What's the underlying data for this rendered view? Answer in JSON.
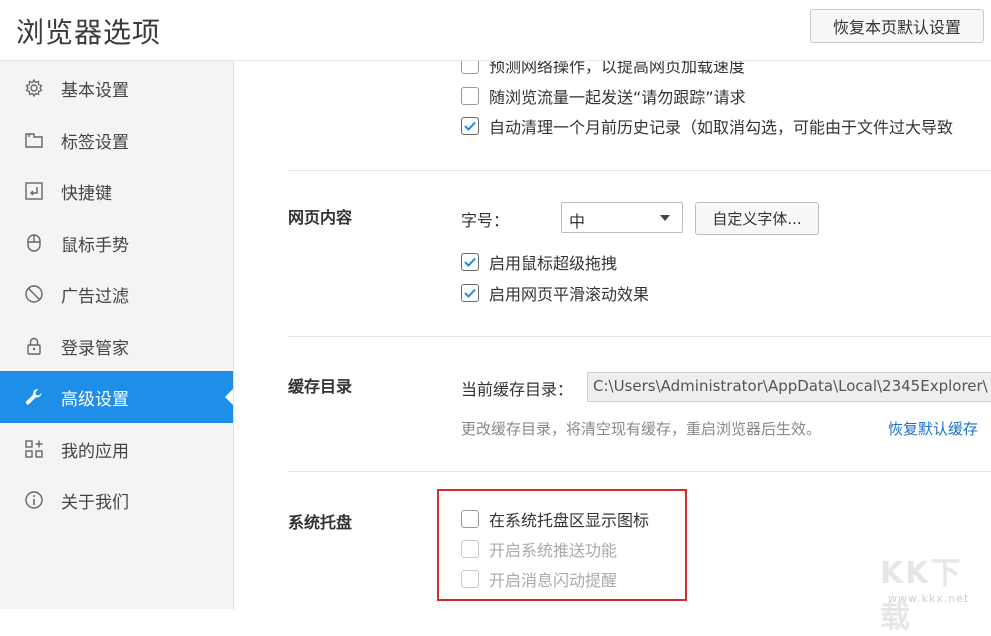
{
  "header": {
    "title": "浏览器选项",
    "reset_button": "恢复本页默认设置"
  },
  "sidebar": {
    "items": [
      {
        "label": "基本设置",
        "icon": "gear-icon"
      },
      {
        "label": "标签设置",
        "icon": "tabs-icon"
      },
      {
        "label": "快捷键",
        "icon": "shortcut-icon"
      },
      {
        "label": "鼠标手势",
        "icon": "mouse-icon"
      },
      {
        "label": "广告过滤",
        "icon": "block-icon"
      },
      {
        "label": "登录管家",
        "icon": "lock-icon"
      },
      {
        "label": "高级设置",
        "icon": "wrench-icon",
        "active": true
      },
      {
        "label": "我的应用",
        "icon": "apps-icon"
      },
      {
        "label": "关于我们",
        "icon": "info-icon"
      }
    ]
  },
  "privacy": {
    "options": [
      {
        "label": "预测网络操作，以提高网页加载速度",
        "checked": false
      },
      {
        "label": "随浏览流量一起发送“请勿跟踪”请求",
        "checked": false
      },
      {
        "label": "自动清理一个月前历史记录（如取消勾选，可能由于文件过大导致",
        "checked": true
      }
    ]
  },
  "web_content": {
    "title": "网页内容",
    "font_size_label": "字号：",
    "font_size_value": "中",
    "custom_font_button": "自定义字体...",
    "options": [
      {
        "label": "启用鼠标超级拖拽",
        "checked": true
      },
      {
        "label": "启用网页平滑滚动效果",
        "checked": true
      }
    ]
  },
  "cache": {
    "title": "缓存目录",
    "current_label": "当前缓存目录：",
    "path": "C:\\Users\\Administrator\\AppData\\Local\\2345Explorer\\",
    "note": "更改缓存目录，将清空现有缓存，重启浏览器后生效。",
    "reset_link": "恢复默认缓存"
  },
  "tray": {
    "title": "系统托盘",
    "options": [
      {
        "label": "在系统托盘区显示图标",
        "checked": false,
        "disabled": false
      },
      {
        "label": "开启系统推送功能",
        "checked": false,
        "disabled": true
      },
      {
        "label": "开启消息闪动提醒",
        "checked": false,
        "disabled": true
      }
    ]
  },
  "watermark": {
    "text": "KK下载",
    "url": "www.kkx.net"
  },
  "colors": {
    "accent": "#1f8ee8",
    "highlight": "#d42a2a",
    "link": "#1a73c9"
  }
}
